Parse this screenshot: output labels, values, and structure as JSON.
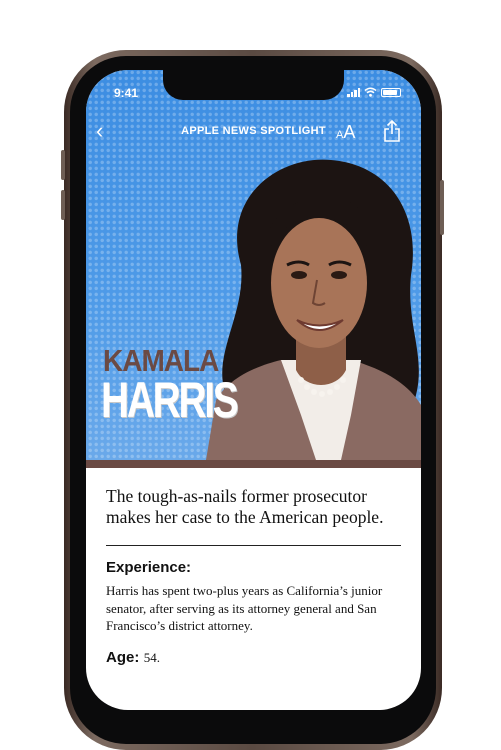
{
  "status_bar": {
    "time": "9:41"
  },
  "nav": {
    "title": "APPLE NEWS SPOTLIGHT",
    "text_size_small": "A",
    "text_size_large": "A"
  },
  "hero": {
    "first_name": "KAMALA",
    "last_name": "HARRIS"
  },
  "article": {
    "dek": "The tough-as-nails former prosecutor makes her case to the American people.",
    "experience_heading": "Experience:",
    "experience_body": "Harris has spent two-plus years as California’s junior senator, after serving as its attorney general and San Francisco’s district attorney.",
    "age_label": "Age:",
    "age_value": "54."
  },
  "colors": {
    "sky": "#4f9be8",
    "accent": "#6b4a44"
  }
}
